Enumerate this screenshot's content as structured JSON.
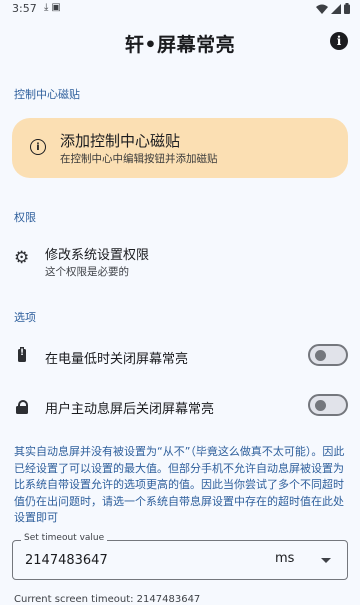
{
  "status_bar": {
    "time": "3:57"
  },
  "app": {
    "title": "轩•屏幕常亮"
  },
  "sections": {
    "control_center": "控制中心磁贴",
    "permissions": "权限",
    "options": "选项"
  },
  "tile_card": {
    "title": "添加控制中心磁贴",
    "subtitle": "在控制中心中编辑按钮并添加磁贴"
  },
  "permission_item": {
    "title": "修改系统设置权限",
    "subtitle": "这个权限是必要的"
  },
  "options": [
    {
      "label": "在电量低时关闭屏幕常亮",
      "enabled": false,
      "icon": "battery-alert-icon"
    },
    {
      "label": "用户主动息屏后关闭屏幕常亮",
      "enabled": false,
      "icon": "lock-icon"
    }
  ],
  "explanation": "其实自动息屏并没有被设置为“从不”（毕竟这么做真不太可能）。因此已经设置了可以设置的最大值。但部分手机不允许自动息屏被设置为比系统自带设置允许的选项更高的值。因此当你尝试了多个不同超时值仍在出问题时，请选一个系统自带息屏设置中存在的超时值在此处设置即可",
  "timeout": {
    "label": "Set timeout value",
    "value": "2147483647",
    "unit": "ms"
  },
  "current_timeout": "Current screen timeout: 2147483647",
  "colors": {
    "background": "#f6f9fe",
    "accent": "#2e5f9c",
    "tile_card": "#fbdfb3"
  }
}
